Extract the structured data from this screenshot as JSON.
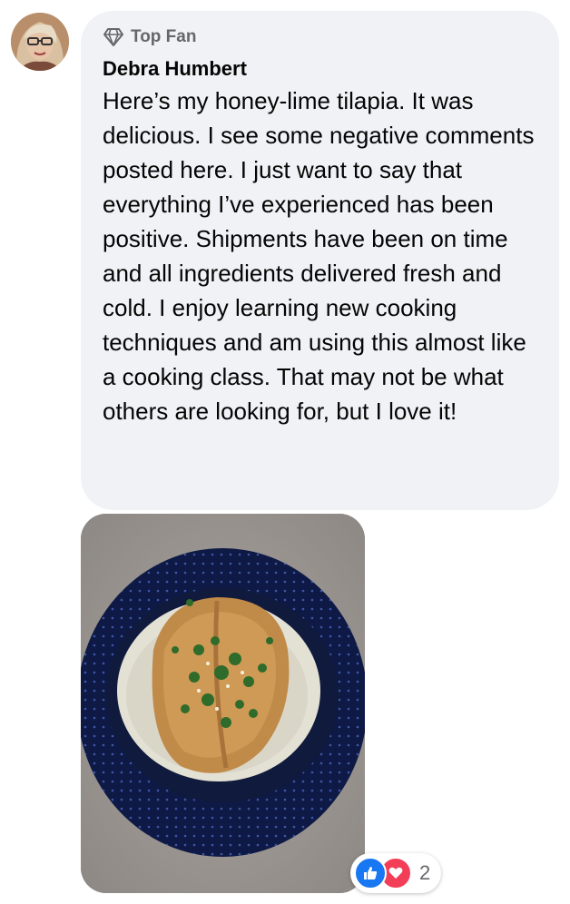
{
  "comment": {
    "badge": {
      "icon": "diamond-icon",
      "label": "Top Fan"
    },
    "author": "Debra Humbert",
    "text": "Here’s my honey-lime tilapia. It was delicious. I see some negative comments posted here. I just want to say that everything I’ve experienced has been positive. Shipments have been on time and all ingredients delivered fresh and cold. I enjoy learning new cooking techniques and am using this almost like a cooking class. That may not be what others are looking for, but I love it!",
    "reactions": {
      "icons": [
        "like-icon",
        "love-icon"
      ],
      "count": "2"
    }
  },
  "colors": {
    "bubble": "#f0f2f5",
    "secondary_text": "#65676b",
    "like": "#1877f2",
    "love": "#f33e58"
  }
}
